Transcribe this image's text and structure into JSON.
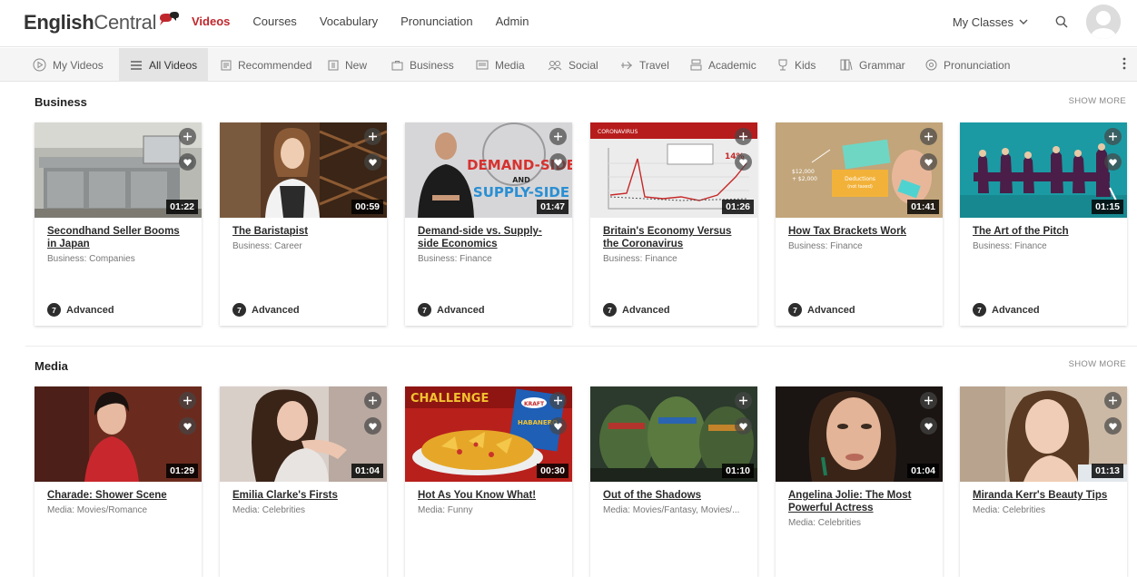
{
  "header": {
    "logo_bold": "English",
    "logo_light": "Central",
    "nav": [
      {
        "label": "Videos",
        "active": true
      },
      {
        "label": "Courses"
      },
      {
        "label": "Vocabulary"
      },
      {
        "label": "Pronunciation"
      },
      {
        "label": "Admin"
      }
    ],
    "my_classes": "My Classes"
  },
  "categories": [
    {
      "label": "My Videos",
      "icon": "play-icon"
    },
    {
      "label": "All Videos",
      "icon": "list-icon",
      "active": true
    },
    {
      "label": "Recommended",
      "icon": "recommended-icon"
    },
    {
      "label": "New",
      "icon": "new-icon"
    },
    {
      "label": "Business",
      "icon": "briefcase-icon"
    },
    {
      "label": "Media",
      "icon": "media-icon"
    },
    {
      "label": "Social",
      "icon": "people-icon"
    },
    {
      "label": "Travel",
      "icon": "plane-icon"
    },
    {
      "label": "Academic",
      "icon": "academic-icon"
    },
    {
      "label": "Kids",
      "icon": "kids-icon"
    },
    {
      "label": "Grammar",
      "icon": "grammar-icon"
    },
    {
      "label": "Pronunciation",
      "icon": "pronunciation-icon"
    }
  ],
  "sections": [
    {
      "title": "Business",
      "show_more": "SHOW MORE",
      "videos": [
        {
          "title": "Secondhand Seller Booms in Japan",
          "category": "Business: Companies",
          "duration": "01:22",
          "level": "Advanced",
          "level_num": "7"
        },
        {
          "title": "The Baristapist",
          "category": "Business: Career",
          "duration": "00:59",
          "level": "Advanced",
          "level_num": "7"
        },
        {
          "title": "Demand-side vs. Supply-side Economics",
          "category": "Business: Finance",
          "duration": "01:47",
          "level": "Advanced",
          "level_num": "7"
        },
        {
          "title": "Britain's Economy Versus the Coronavirus",
          "category": "Business: Finance",
          "duration": "01:26",
          "level": "Advanced",
          "level_num": "7"
        },
        {
          "title": "How Tax Brackets Work",
          "category": "Business: Finance",
          "duration": "01:41",
          "level": "Advanced",
          "level_num": "7"
        },
        {
          "title": "The Art of the Pitch",
          "category": "Business: Finance",
          "duration": "01:15",
          "level": "Advanced",
          "level_num": "7"
        }
      ]
    },
    {
      "title": "Media",
      "show_more": "SHOW MORE",
      "videos": [
        {
          "title": "Charade: Shower Scene",
          "category": "Media: Movies/Romance",
          "duration": "01:29"
        },
        {
          "title": "Emilia Clarke's Firsts",
          "category": "Media: Celebrities",
          "duration": "01:04"
        },
        {
          "title": "Hot As You Know What!",
          "category": "Media: Funny",
          "duration": "00:30"
        },
        {
          "title": "Out of the Shadows",
          "category": "Media: Movies/Fantasy, Movies/...",
          "duration": "01:10"
        },
        {
          "title": "Angelina Jolie: The Most Powerful Actress",
          "category": "Media: Celebrities",
          "duration": "01:04"
        },
        {
          "title": "Miranda Kerr's Beauty Tips",
          "category": "Media: Celebrities",
          "duration": "01:13"
        }
      ]
    }
  ],
  "thumb_text": {
    "demand": "DEMAND-SIDE",
    "and": "AND",
    "supply": "SUPPLY-SIDE",
    "corona": "CORONAVIRUS",
    "pct": "14%",
    "tax_amount": "$12,000",
    "tax_plus": "+ $2,000",
    "deductions": "Deductions",
    "not_taxed": "(not taxed)",
    "challenge": "CHALLENGE",
    "kraft": "KRAFT",
    "habanero": "HABANERO"
  },
  "colors": {
    "brand_red": "#c0272d",
    "level_badge": "#2d2d2d"
  }
}
